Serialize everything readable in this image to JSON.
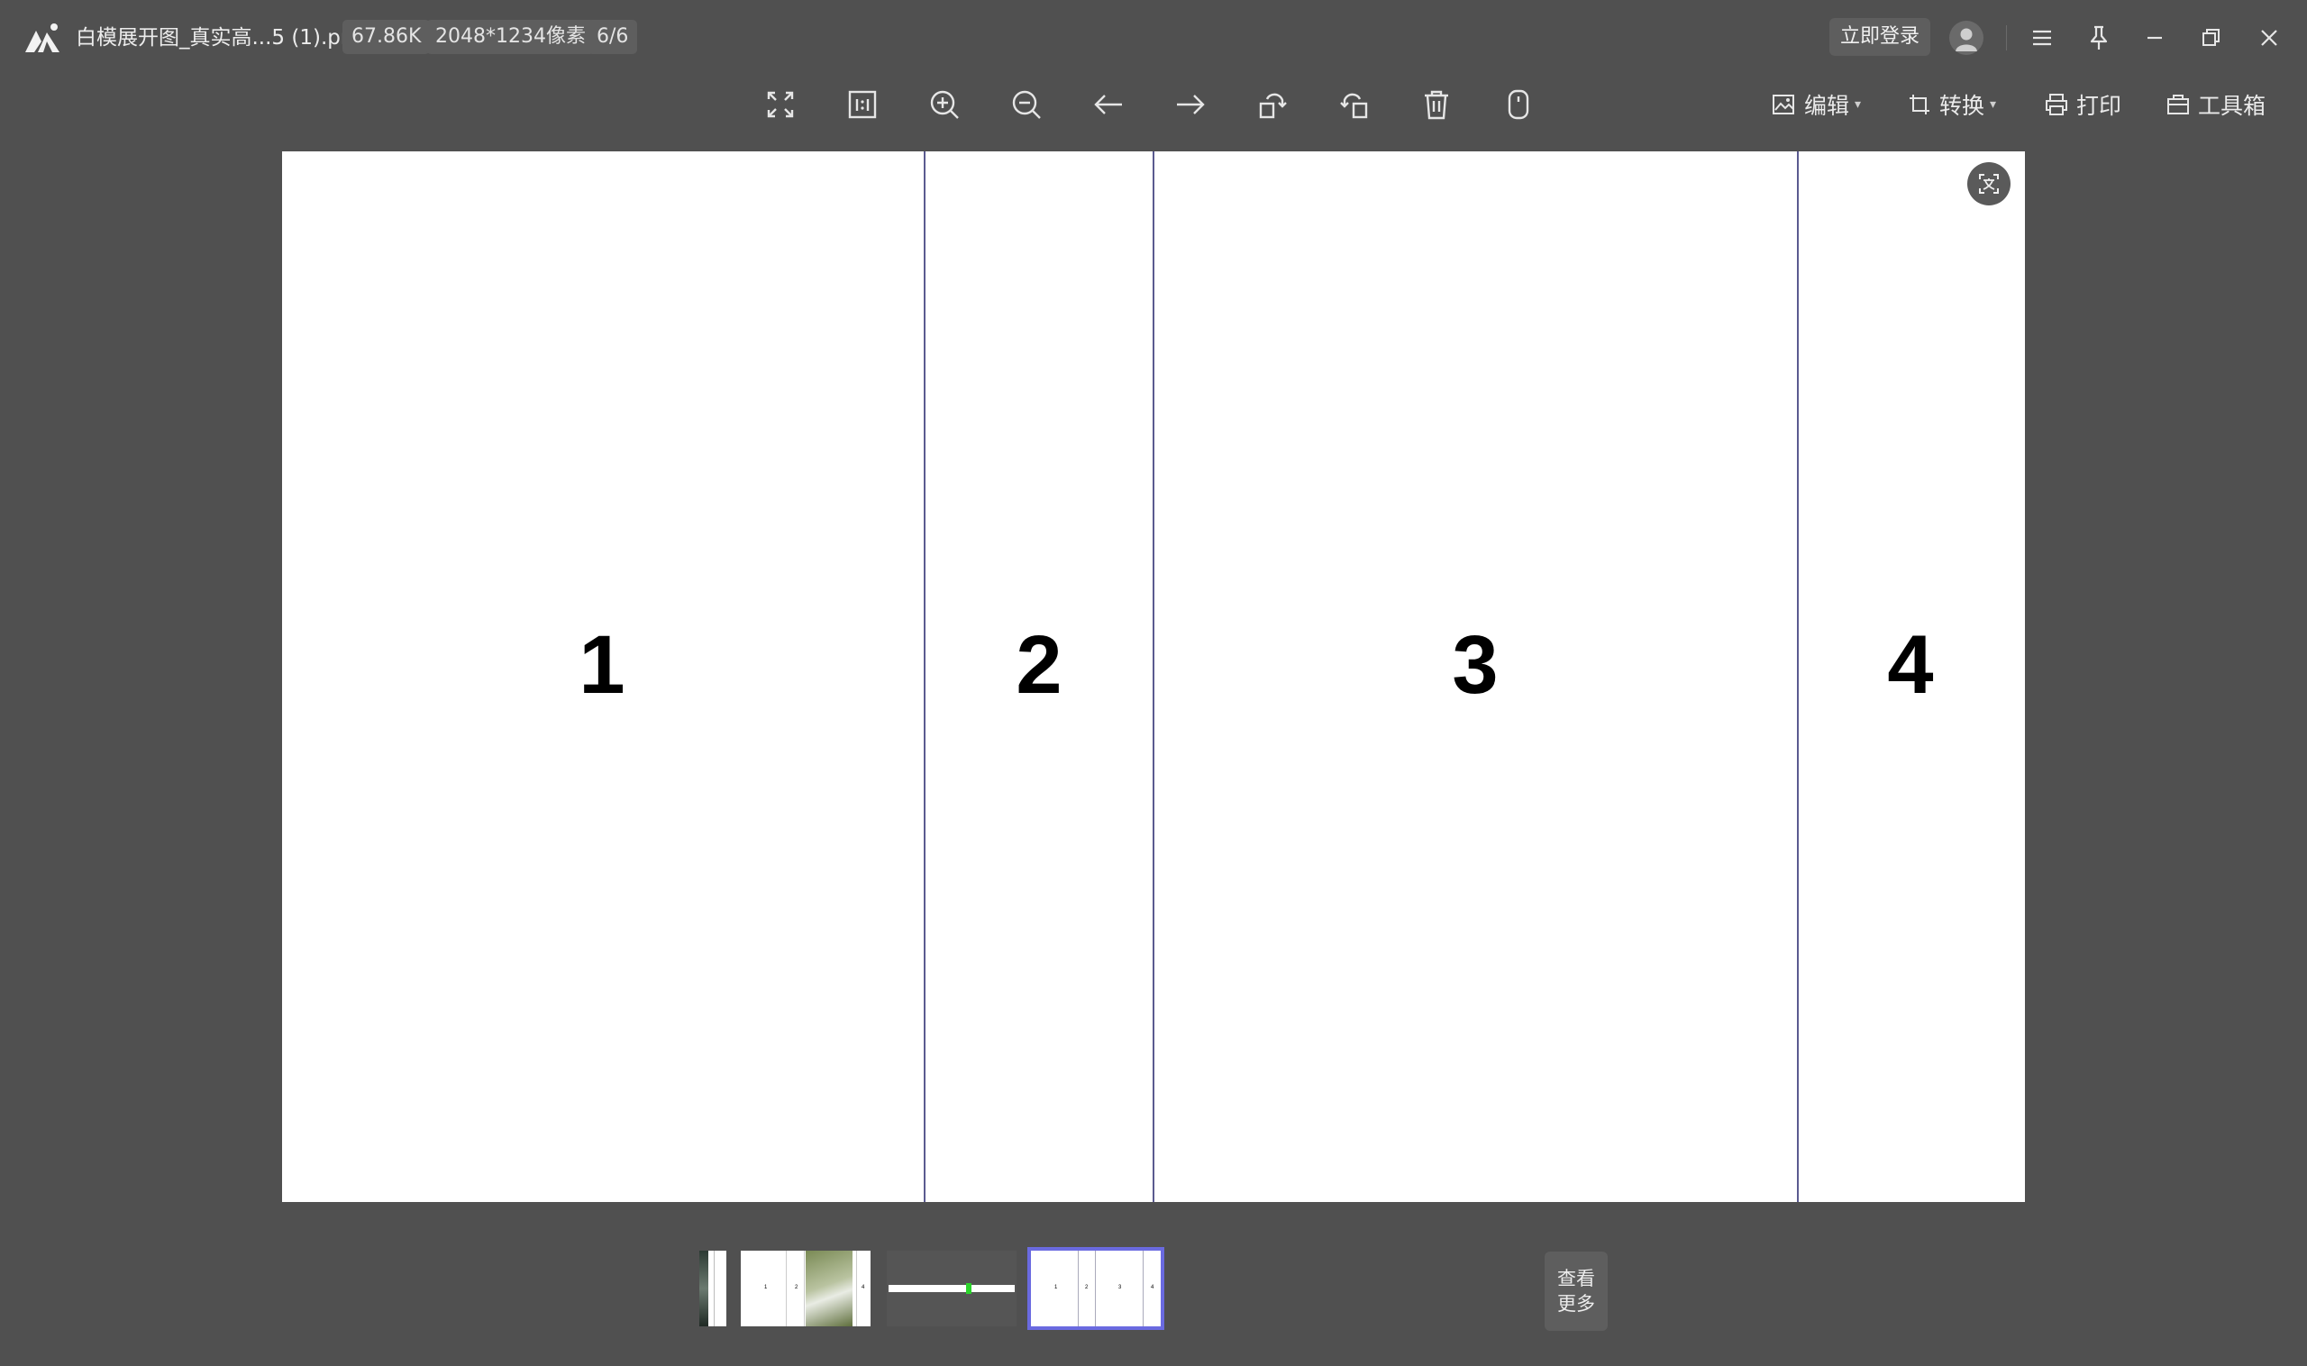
{
  "titlebar": {
    "filename": "白模展开图_真实高...5 (1).png",
    "file_size": "67.86K",
    "dimensions": "2048*1234像素",
    "position": "6/6",
    "login_label": "立即登录"
  },
  "toolbar": {
    "edit_label": "编辑",
    "convert_label": "转换",
    "print_label": "打印",
    "toolbox_label": "工具箱"
  },
  "image": {
    "panels": [
      "1",
      "2",
      "3",
      "4"
    ]
  },
  "filmstrip": {
    "more_line1": "查看",
    "more_line2": "更多",
    "selected_index": 4
  },
  "colors": {
    "background": "#505050",
    "chip": "#5e5e5e",
    "selection": "#6a6ae0",
    "divider": "#5a5a90"
  }
}
